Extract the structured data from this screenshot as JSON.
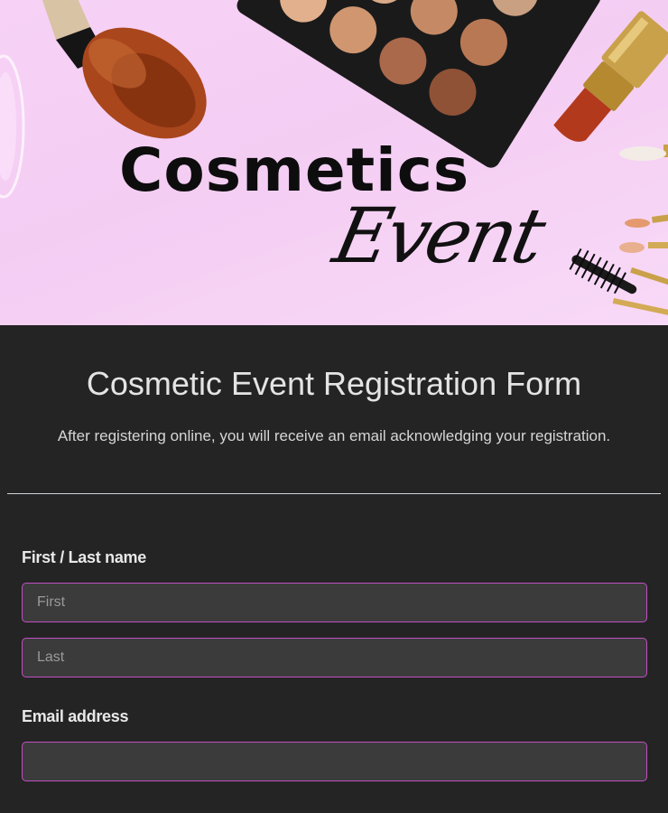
{
  "banner": {
    "title": "Cosmetics",
    "script": "Event"
  },
  "form": {
    "title": "Cosmetic Event Registration Form",
    "subtitle": "After registering online, you will receive an email acknowledging your registration.",
    "name_field": {
      "label": "First / Last name",
      "first_placeholder": "First",
      "last_placeholder": "Last",
      "first_value": "",
      "last_value": ""
    },
    "email_field": {
      "label": "Email address",
      "placeholder": "",
      "value": ""
    }
  },
  "colors": {
    "banner_background": "#f5cff4",
    "form_background": "#242424",
    "input_border": "#c24fc4",
    "input_background": "#3b3b3b"
  }
}
